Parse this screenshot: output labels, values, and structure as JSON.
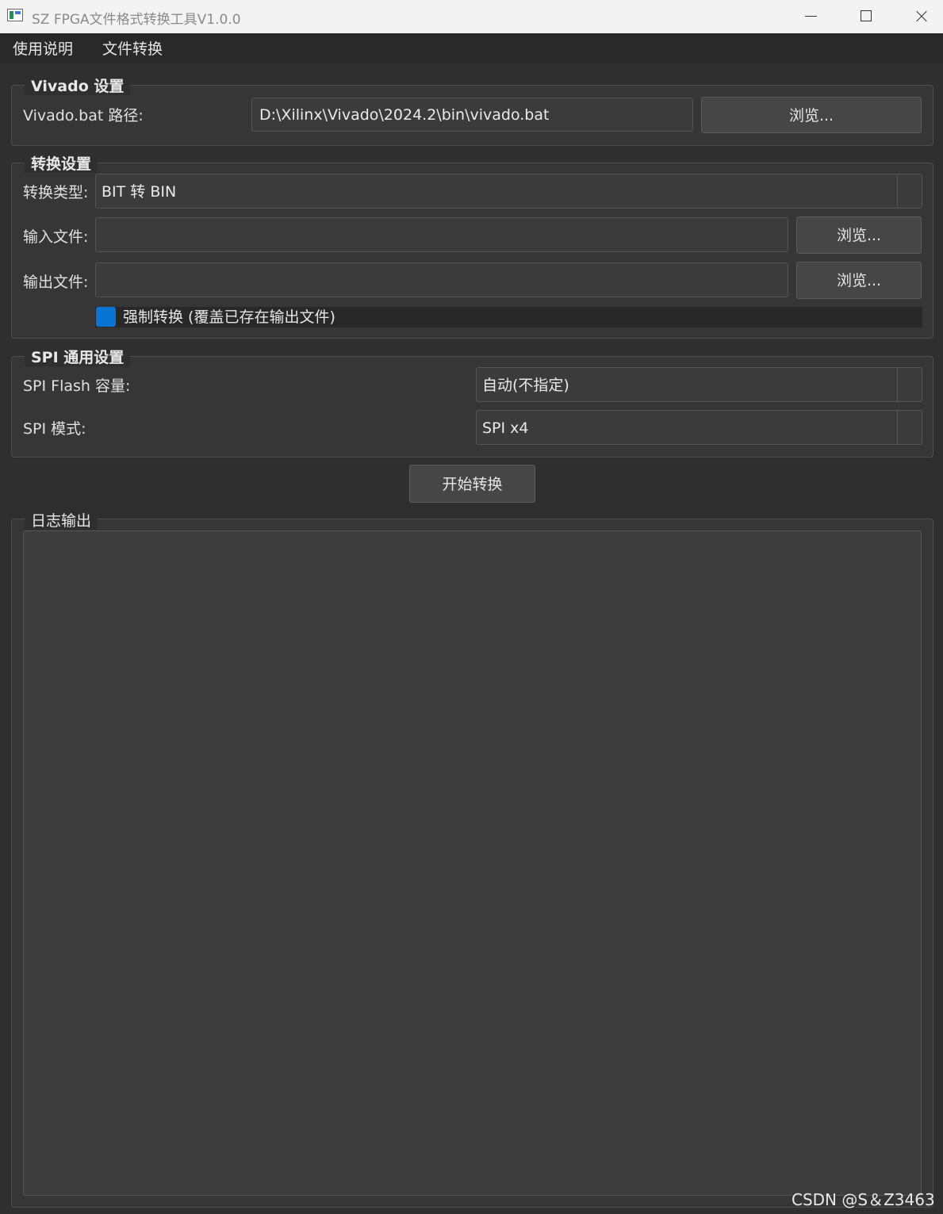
{
  "window": {
    "title": "SZ FPGA文件格式转换工具V1.0.0"
  },
  "menu": {
    "items": [
      "使用说明",
      "文件转换"
    ]
  },
  "vivado": {
    "group_title": "Vivado 设置",
    "path_label": "Vivado.bat 路径:",
    "path_value": "D:\\Xilinx\\Vivado\\2024.2\\bin\\vivado.bat",
    "browse_label": "浏览..."
  },
  "convert": {
    "group_title": "转换设置",
    "type_label": "转换类型:",
    "type_value": "BIT 转 BIN",
    "input_label": "输入文件:",
    "input_value": "",
    "input_browse": "浏览...",
    "output_label": "输出文件:",
    "output_value": "",
    "output_browse": "浏览...",
    "force_label": "强制转换 (覆盖已存在输出文件)",
    "force_checked": true
  },
  "spi": {
    "group_title": "SPI 通用设置",
    "capacity_label": "SPI Flash 容量:",
    "capacity_value": "自动(不指定)",
    "mode_label": "SPI 模式:",
    "mode_value": "SPI x4"
  },
  "actions": {
    "start_label": "开始转换"
  },
  "log": {
    "group_title": "日志输出",
    "content": ""
  },
  "watermark": "CSDN @S＆Z3463",
  "colors": {
    "accent": "#0a74d4",
    "background": "#2f2f2f",
    "titlebar": "#f3f3f3"
  }
}
